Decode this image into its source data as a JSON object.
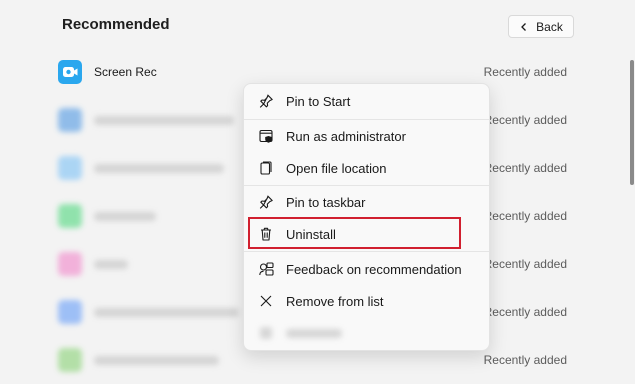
{
  "header": {
    "title": "Recommended",
    "back_label": "Back"
  },
  "list": {
    "first_item": {
      "name": "Screen Rec",
      "meta": "Recently added"
    },
    "meta_labels": [
      "Recently added",
      "Recently added",
      "Recently added",
      "Recently added",
      "Recently added",
      "Recently added"
    ]
  },
  "context_menu": {
    "items": [
      {
        "label": "Pin to Start",
        "icon": "pin-icon"
      },
      {
        "label": "Run as administrator",
        "icon": "shield-window-icon"
      },
      {
        "label": "Open file location",
        "icon": "folder-file-icon"
      },
      {
        "label": "Pin to taskbar",
        "icon": "pin-icon"
      },
      {
        "label": "Uninstall",
        "icon": "trash-icon"
      },
      {
        "label": "Feedback on recommendation",
        "icon": "feedback-icon"
      },
      {
        "label": "Remove from list",
        "icon": "close-icon"
      }
    ],
    "highlighted_item": "Uninstall",
    "highlight_color": "#d1202f"
  },
  "colors": {
    "background": "#f3f3f3",
    "app_icon_accent": "#2aa7ee"
  }
}
